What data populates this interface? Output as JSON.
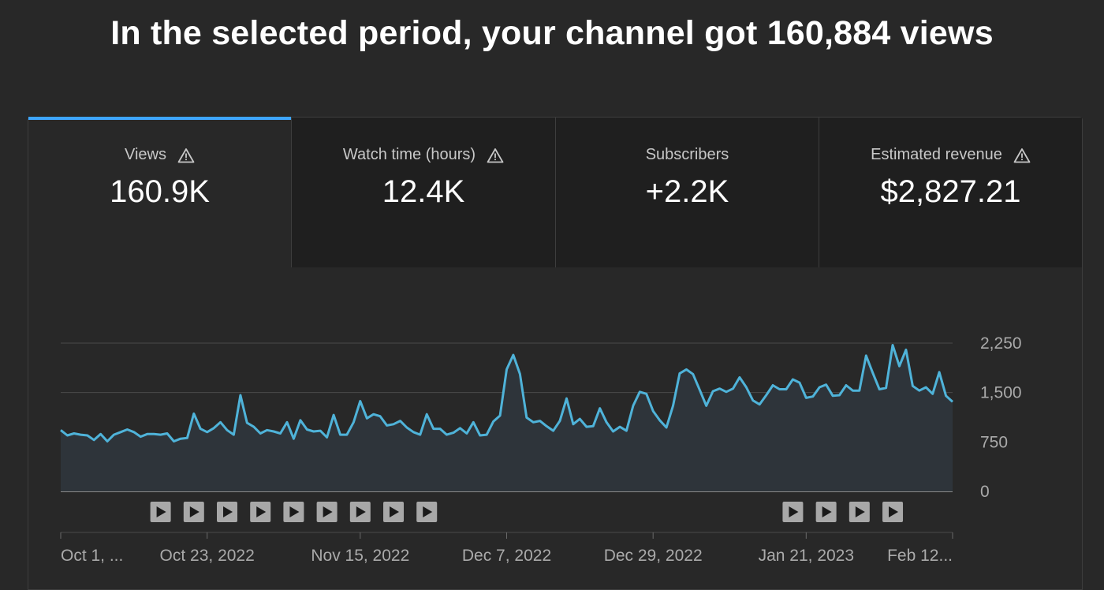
{
  "headline": "In the selected period, your channel got 160,884 views",
  "tabs": [
    {
      "label": "Views",
      "value": "160.9K",
      "warning": true,
      "active": true
    },
    {
      "label": "Watch time (hours)",
      "value": "12.4K",
      "warning": true,
      "active": false
    },
    {
      "label": "Subscribers",
      "value": "+2.2K",
      "warning": false,
      "active": false
    },
    {
      "label": "Estimated revenue",
      "value": "$2,827.21",
      "warning": true,
      "active": false
    }
  ],
  "colors": {
    "accent": "#3ea6ff",
    "line": "#4fb3d9",
    "area": "#2e343a"
  },
  "icons": {
    "warning": "warning-triangle-icon",
    "video_marker": "play-icon"
  },
  "chart_data": {
    "type": "area",
    "y_ticks": [
      "2,250",
      "1,500",
      "750",
      "0"
    ],
    "y_tick_values": [
      2250,
      1500,
      750,
      0
    ],
    "ylim": [
      0,
      2250
    ],
    "x_tick_labels": [
      "Oct 1, ...",
      "Oct 23, 2022",
      "Nov 15, 2022",
      "Dec 7, 2022",
      "Dec 29, 2022",
      "Jan 21, 2023",
      "Feb 12..."
    ],
    "x_tick_dates": [
      "2022-10-01",
      "2022-10-23",
      "2022-11-15",
      "2022-12-07",
      "2022-12-29",
      "2023-01-21",
      "2023-02-12"
    ],
    "series": [
      {
        "values": [
          930,
          850,
          880,
          860,
          850,
          780,
          870,
          760,
          860,
          900,
          940,
          900,
          830,
          870,
          870,
          860,
          880,
          760,
          800,
          810,
          1180,
          950,
          900,
          960,
          1050,
          930,
          860,
          1460,
          1040,
          980,
          880,
          930,
          910,
          880,
          1050,
          800,
          1080,
          940,
          910,
          920,
          820,
          1160,
          860,
          860,
          1050,
          1370,
          1110,
          1170,
          1140,
          1000,
          1020,
          1070,
          970,
          900,
          860,
          1170,
          950,
          950,
          860,
          890,
          960,
          880,
          1050,
          850,
          860,
          1060,
          1150,
          1850,
          2070,
          1780,
          1120,
          1050,
          1070,
          990,
          920,
          1070,
          1410,
          1020,
          1100,
          980,
          990,
          1260,
          1050,
          910,
          980,
          920,
          1300,
          1510,
          1480,
          1220,
          1080,
          970,
          1300,
          1790,
          1850,
          1780,
          1540,
          1300,
          1520,
          1560,
          1510,
          1560,
          1730,
          1580,
          1380,
          1320,
          1460,
          1610,
          1550,
          1550,
          1700,
          1650,
          1420,
          1440,
          1580,
          1620,
          1450,
          1460,
          1610,
          1530,
          1530,
          2060,
          1800,
          1550,
          1570,
          2220,
          1900,
          2150,
          1600,
          1530,
          1580,
          1480,
          1810,
          1450,
          1360
        ]
      }
    ],
    "video_markers_after_ticks": [
      "2022-10-16",
      "2022-10-21",
      "2022-10-26",
      "2022-10-31",
      "2022-11-05",
      "2022-11-10",
      "2022-11-15",
      "2022-11-20",
      "2022-11-25",
      "2023-01-19",
      "2023-01-24",
      "2023-01-29",
      "2023-02-03"
    ]
  }
}
